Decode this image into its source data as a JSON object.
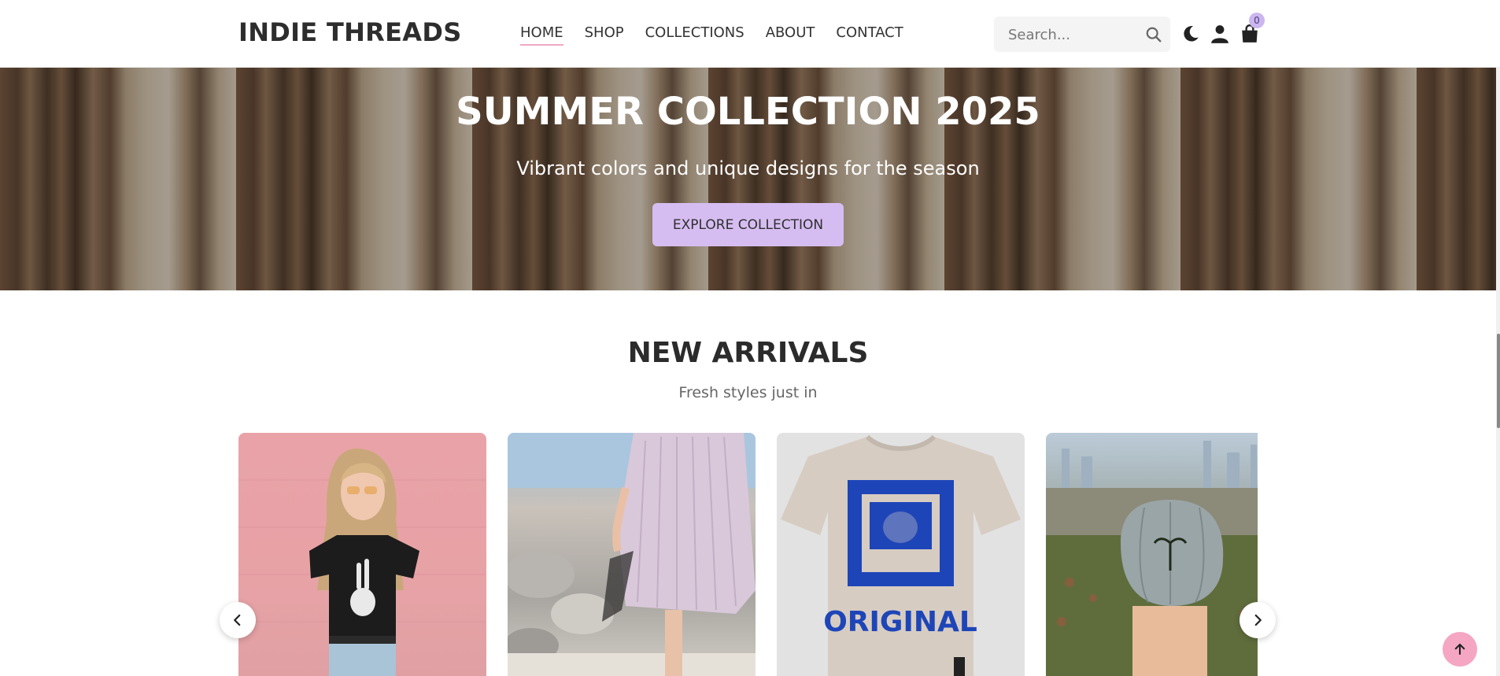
{
  "header": {
    "logo": "INDIE THREADS",
    "nav": [
      {
        "label": "HOME",
        "active": true
      },
      {
        "label": "SHOP",
        "active": false
      },
      {
        "label": "COLLECTIONS",
        "active": false
      },
      {
        "label": "ABOUT",
        "active": false
      },
      {
        "label": "CONTACT",
        "active": false
      }
    ],
    "search_placeholder": "Search...",
    "cart_count": "0",
    "icons": [
      "search-icon",
      "moon-icon",
      "user-icon",
      "shopping-bag-icon"
    ]
  },
  "hero": {
    "title": "SUMMER COLLECTION 2025",
    "subtitle": "Vibrant colors and unique designs for the season",
    "button_label": "EXPLORE COLLECTION"
  },
  "new_arrivals": {
    "title": "NEW ARRIVALS",
    "subtitle": "Fresh styles just in",
    "products": [
      {
        "image": "model in black skeleton-hand t-shirt against pink wall"
      },
      {
        "image": "pleated lilac skirt with sandals on beach"
      },
      {
        "image": "beige t-shirt with blue lucky cat ORIGINAL print"
      },
      {
        "image": "grey denim cap with palm tree embroidery"
      }
    ],
    "tshirt_print_text": "ORIGINAL"
  },
  "colors": {
    "accent_purple": "#d6bdf1",
    "accent_pink": "#f4a6c3",
    "text_dark": "#2b2b2b"
  }
}
